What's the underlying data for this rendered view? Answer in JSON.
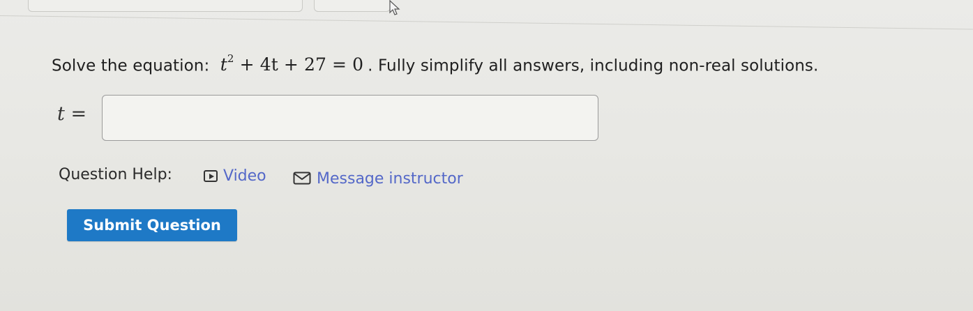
{
  "question": {
    "prompt_prefix": "Solve the equation:",
    "equation_var": "t",
    "equation_exponent": "2",
    "equation_rest": "+ 4t + 27 = 0",
    "prompt_suffix": ".  Fully simplify all answers, including non-real solutions."
  },
  "answer": {
    "label_var": "t",
    "label_equals": "=",
    "input_value": "",
    "input_placeholder": ""
  },
  "help": {
    "label": "Question Help:",
    "video_label": "Video",
    "message_label": "Message instructor"
  },
  "actions": {
    "submit_label": "Submit Question"
  },
  "colors": {
    "link": "#5468c8",
    "submit_bg": "#1e79c6",
    "background": "#e8e8e4"
  },
  "icons": {
    "video": "video-play-icon",
    "message": "mail-envelope-icon",
    "cursor": "mouse-pointer-icon"
  }
}
